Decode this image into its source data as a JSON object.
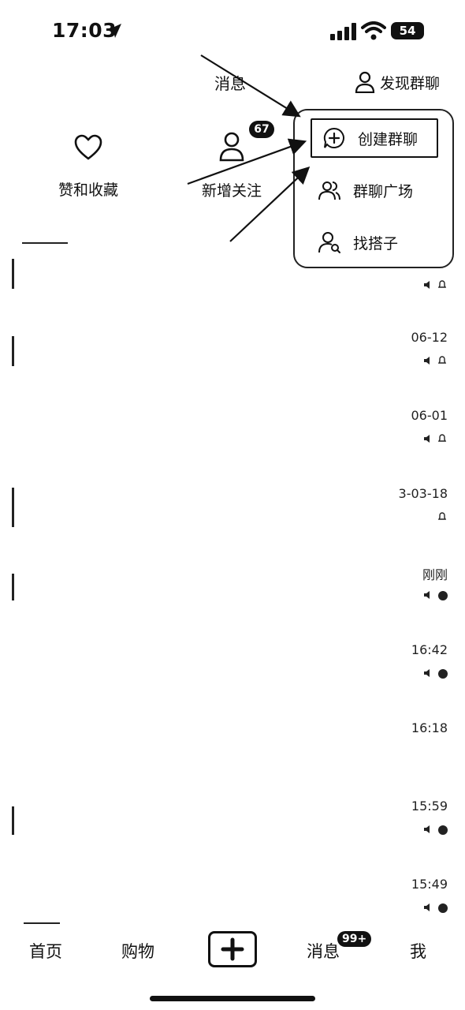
{
  "status": {
    "time": "17:03",
    "battery": "54"
  },
  "header": {
    "title": "消息",
    "discover_label": "发现群聊"
  },
  "quick_actions": {
    "likes_label": "赞和收藏",
    "follow_label": "新增关注",
    "follow_badge": "67"
  },
  "popup": {
    "items": [
      {
        "label": "创建群聊",
        "icon": "chat-plus-icon"
      },
      {
        "label": "群聊广场",
        "icon": "group-icon"
      },
      {
        "label": "找搭子",
        "icon": "user-search-icon"
      }
    ]
  },
  "conversations": [
    {
      "time": "06-12"
    },
    {
      "time": "06-01"
    },
    {
      "time": "3-03-18"
    },
    {
      "time": "刚刚"
    },
    {
      "time": "16:42"
    },
    {
      "time": "16:18"
    },
    {
      "time": "15:59"
    },
    {
      "time": "15:49"
    }
  ],
  "tabs": {
    "home": "首页",
    "shop": "购物",
    "messages": "消息",
    "messages_badge": "99+",
    "me": "我"
  }
}
